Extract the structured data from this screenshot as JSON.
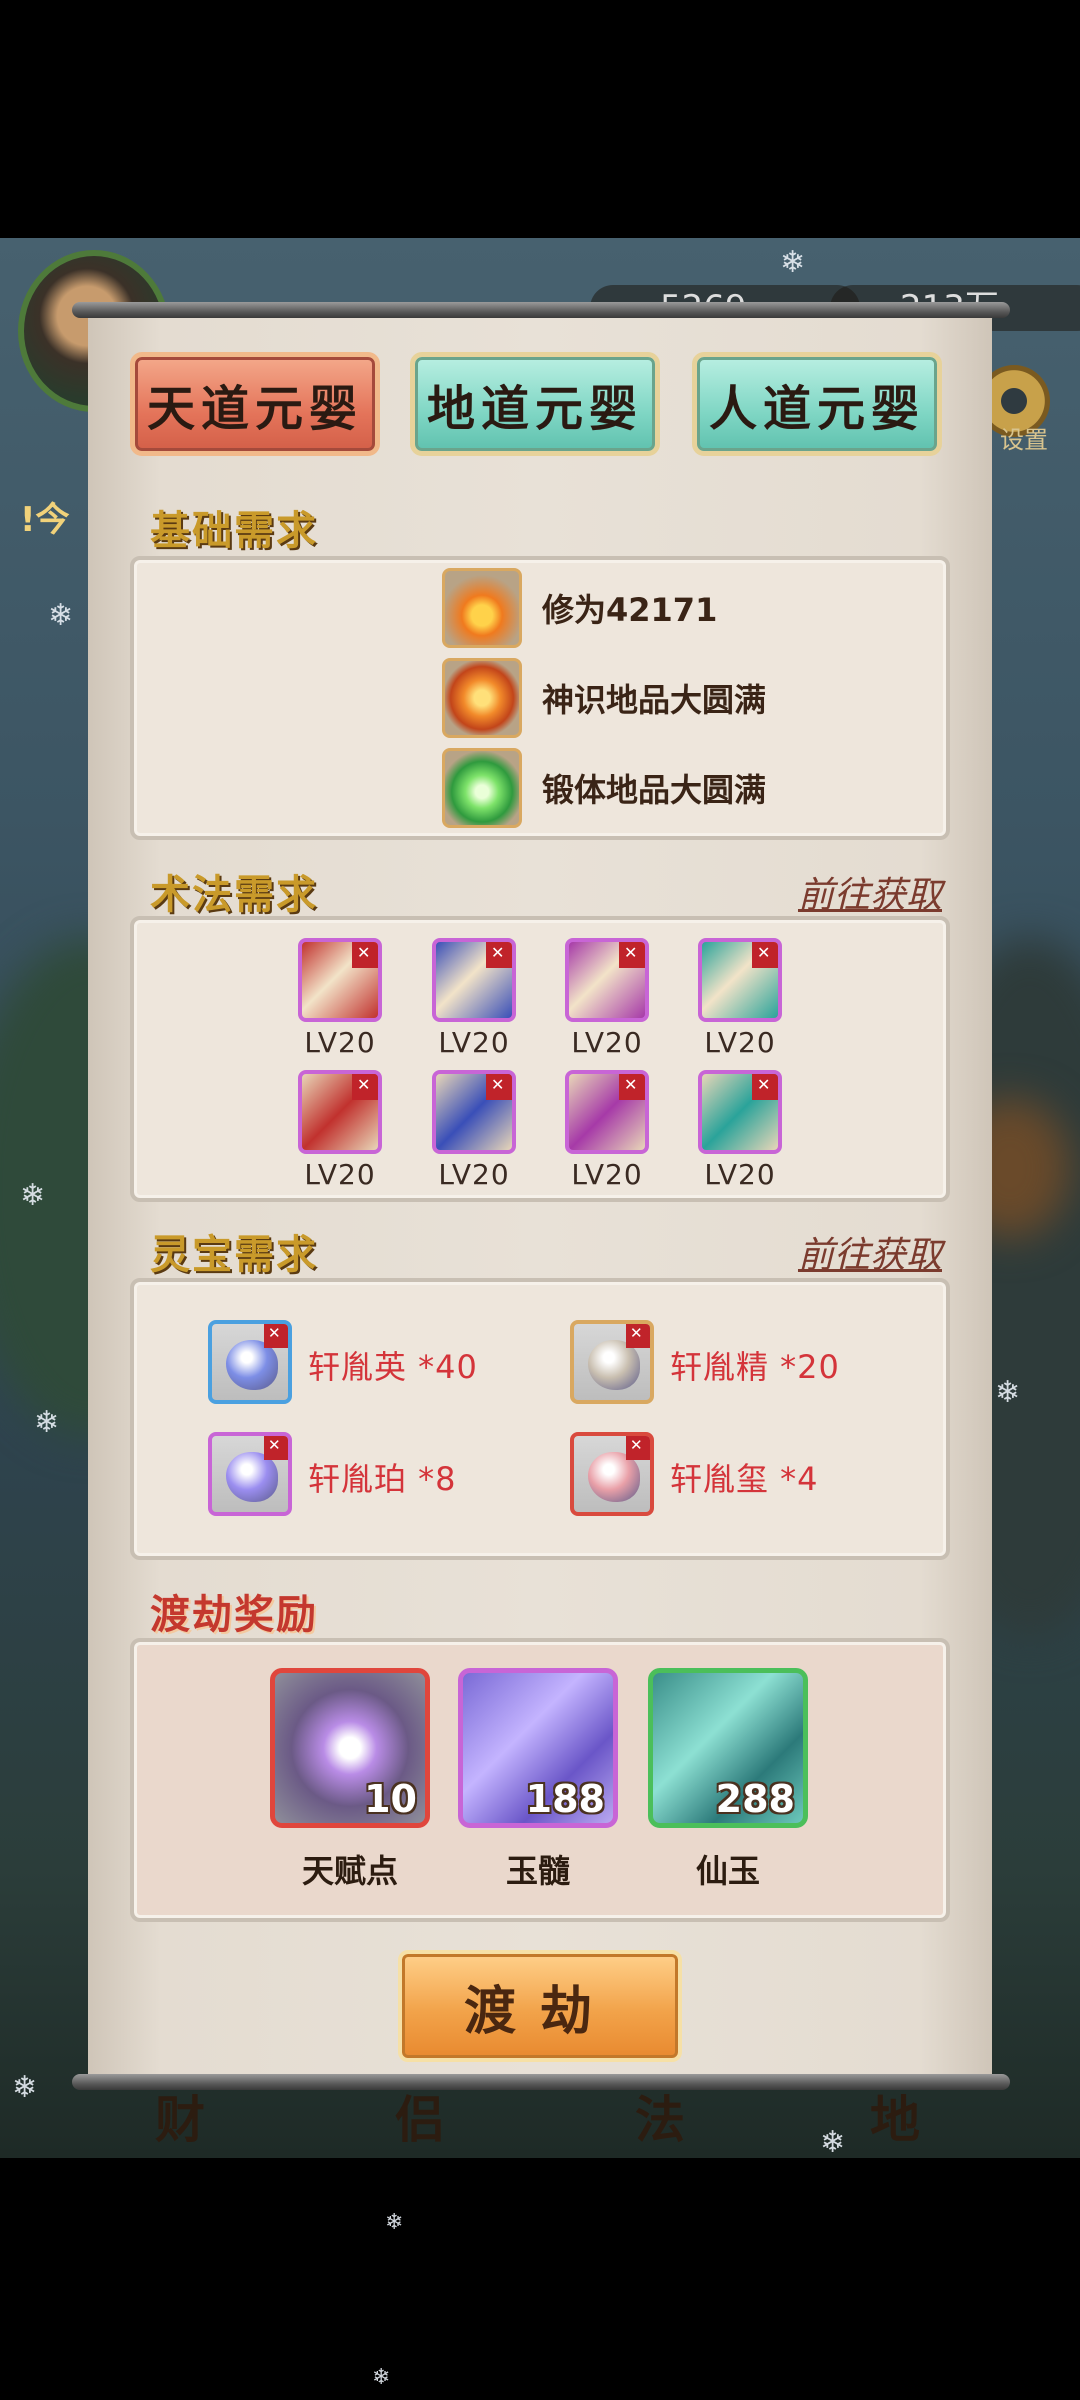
{
  "hud": {
    "currency_left": "5269",
    "currency_right": "213万",
    "settings_label": "设置",
    "side_text": "!今"
  },
  "tabs": [
    {
      "label": "天道元婴",
      "active": true
    },
    {
      "label": "地道元婴",
      "active": false
    },
    {
      "label": "人道元婴",
      "active": false
    }
  ],
  "basic": {
    "title": "基础需求",
    "items": [
      {
        "text": "修为42171",
        "icon": "flame-icon"
      },
      {
        "text": "神识地品大圆满",
        "icon": "fire-beast-icon"
      },
      {
        "text": "锻体地品大圆满",
        "icon": "lotus-icon"
      }
    ]
  },
  "skills": {
    "title": "术法需求",
    "goto": "前往获取",
    "books": [
      {
        "level": "LV20",
        "color": "#c1312e"
      },
      {
        "level": "LV20",
        "color": "#3a4fb8"
      },
      {
        "level": "LV20",
        "color": "#a63aa8"
      },
      {
        "level": "LV20",
        "color": "#2aa39a"
      },
      {
        "level": "LV20",
        "color": "#c1312e"
      },
      {
        "level": "LV20",
        "color": "#3a4fb8"
      },
      {
        "level": "LV20",
        "color": "#a63aa8"
      },
      {
        "level": "LV20",
        "color": "#2aa39a"
      }
    ]
  },
  "treasures": {
    "title": "灵宝需求",
    "goto": "前往获取",
    "items": [
      {
        "text": "轩胤英 *40",
        "border": "#4aa0e0",
        "stone": "#7d8ee6"
      },
      {
        "text": "轩胤精 *20",
        "border": "#d9a860",
        "stone": "#c9bfb0"
      },
      {
        "text": "轩胤珀 *8",
        "border": "#c865d6",
        "stone": "#9b8ef0"
      },
      {
        "text": "轩胤玺 *4",
        "border": "#d94a3e",
        "stone": "#e9a0a8"
      }
    ]
  },
  "rewards": {
    "title": "渡劫奖励",
    "items": [
      {
        "name": "天赋点",
        "count": "10",
        "border": "#e0463c"
      },
      {
        "name": "玉髓",
        "count": "188",
        "border": "#c865d6"
      },
      {
        "name": "仙玉",
        "count": "288",
        "border": "#4bbf5a"
      }
    ]
  },
  "action": {
    "label": "渡劫"
  },
  "bottom_nav": [
    "财",
    "侣",
    "法",
    "地"
  ],
  "colors": {
    "title_gold": "#c99a2a",
    "title_red": "#c4382e",
    "link": "#7b3b2e"
  }
}
